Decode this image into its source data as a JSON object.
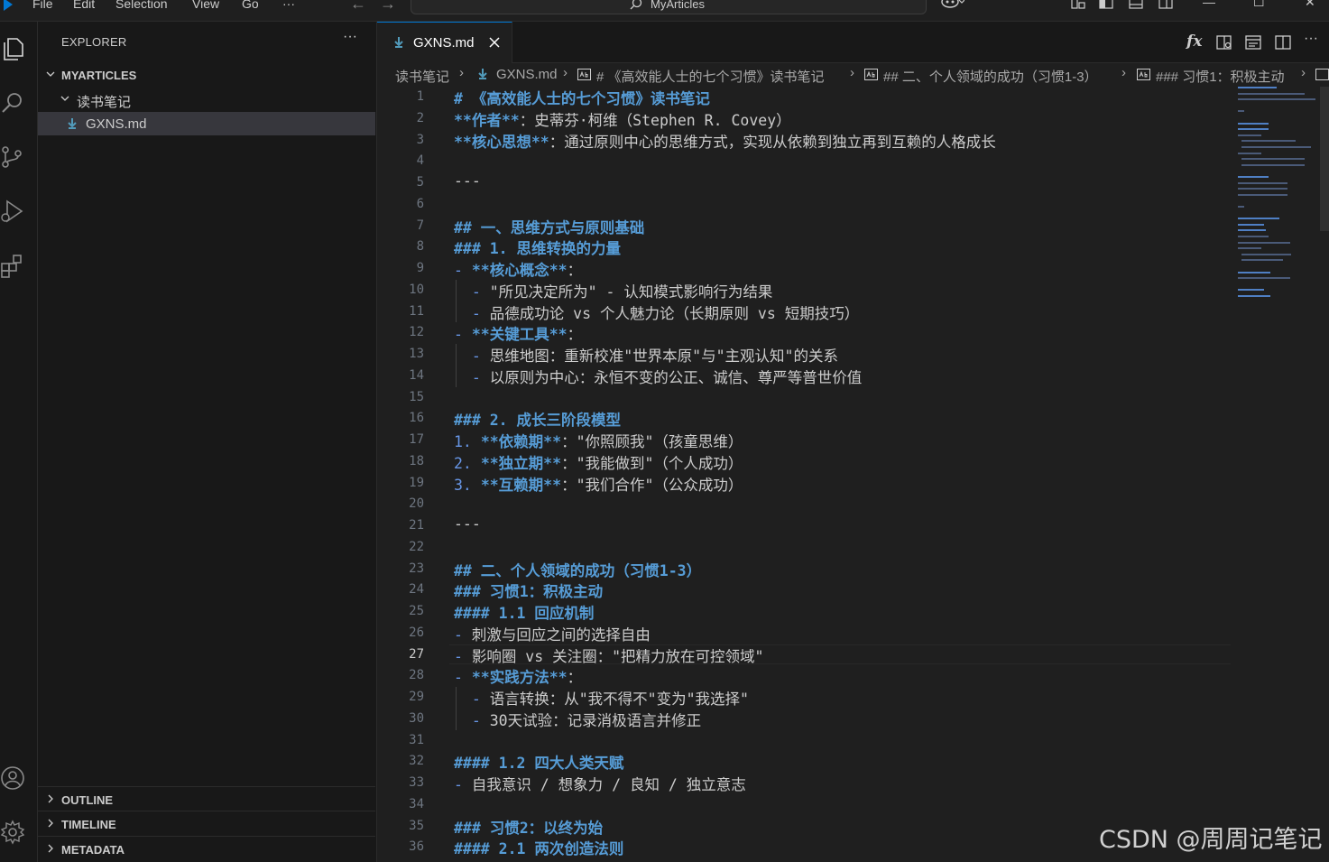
{
  "menu": [
    "File",
    "Edit",
    "Selection",
    "View",
    "Go",
    "···"
  ],
  "command_center": {
    "label": "MyArticles"
  },
  "colors": {
    "accent": "#0078d4",
    "heading": "#569cd6",
    "markdown_icon": "#519aba",
    "selected_row": "#37373d"
  },
  "explorer": {
    "title": "EXPLORER",
    "more": "···",
    "workspace": "MYARTICLES",
    "folder": "读书笔记",
    "file": "GXNS.md",
    "panels": [
      "OUTLINE",
      "TIMELINE",
      "METADATA"
    ]
  },
  "tab": {
    "label": "GXNS.md"
  },
  "editor_actions": {
    "fx": "fx",
    "more": "···"
  },
  "breadcrumb": [
    "读书笔记",
    "GXNS.md",
    "# 《高效能人士的七个习惯》读书笔记",
    "## 二、个人领域的成功（习惯1-3）",
    "### 习惯1：积极主动"
  ],
  "active_line": 27,
  "lines": [
    [
      "h",
      "# 《高效能人士的七个习惯》读书笔记"
    ],
    [
      "b",
      "**作者**",
      "：史蒂芬·柯维（Stephen R. Covey）"
    ],
    [
      "b",
      "**核心思想**",
      "：通过原则中心的思维方式，实现从依赖到独立再到互赖的人格成长"
    ],
    [
      "t",
      ""
    ],
    [
      "t",
      "---"
    ],
    [
      "t",
      ""
    ],
    [
      "h",
      "## 一、思维方式与原则基础"
    ],
    [
      "h",
      "### 1. 思维转换的力量"
    ],
    [
      "lb",
      "- ",
      "**核心概念**",
      "："
    ],
    [
      "sl",
      "  - ",
      "\"所见决定所为\" - 认知模式影响行为结果"
    ],
    [
      "sl",
      "  - ",
      "品德成功论 vs 个人魅力论（长期原则 vs 短期技巧）"
    ],
    [
      "lb",
      "- ",
      "**关键工具**",
      "："
    ],
    [
      "sl",
      "  - ",
      "思维地图：重新校准\"世界本原\"与\"主观认知\"的关系"
    ],
    [
      "sl",
      "  - ",
      "以原则为中心：永恒不变的公正、诚信、尊严等普世价值"
    ],
    [
      "t",
      ""
    ],
    [
      "h",
      "### 2. 成长三阶段模型"
    ],
    [
      "ob",
      "1. ",
      "**依赖期**",
      "：\"你照顾我\"（孩童思维）"
    ],
    [
      "ob",
      "2. ",
      "**独立期**",
      "：\"我能做到\"（个人成功）"
    ],
    [
      "ob",
      "3. ",
      "**互赖期**",
      "：\"我们合作\"（公众成功）"
    ],
    [
      "t",
      ""
    ],
    [
      "t",
      "---"
    ],
    [
      "t",
      ""
    ],
    [
      "h",
      "## 二、个人领域的成功（习惯1-3）"
    ],
    [
      "h",
      "### 习惯1：积极主动"
    ],
    [
      "h",
      "#### 1.1 回应机制"
    ],
    [
      "l",
      "- ",
      "刺激与回应之间的选择自由"
    ],
    [
      "l",
      "- ",
      "影响圈 vs 关注圈：\"把精力放在可控领域\""
    ],
    [
      "lb",
      "- ",
      "**实践方法**",
      "："
    ],
    [
      "sl",
      "  - ",
      "语言转换：从\"我不得不\"变为\"我选择\""
    ],
    [
      "sl",
      "  - ",
      "30天试验：记录消极语言并修正"
    ],
    [
      "t",
      ""
    ],
    [
      "h",
      "#### 1.2 四大人类天赋"
    ],
    [
      "l",
      "- ",
      "自我意识 / 想象力 / 良知 / 独立意志"
    ],
    [
      "t",
      ""
    ],
    [
      "h",
      "### 习惯2：以终为始"
    ],
    [
      "h",
      "#### 2.1 两次创造法则"
    ]
  ],
  "watermark": "CSDN @周周记笔记"
}
